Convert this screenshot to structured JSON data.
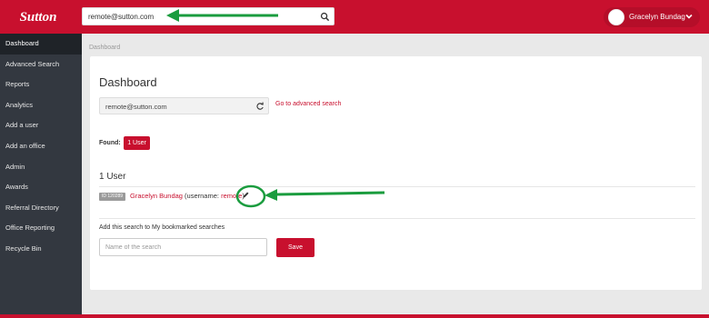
{
  "brand": {
    "logo_text": "Sutton",
    "accent_color": "#c8102e"
  },
  "search": {
    "value": "remote@sutton.com",
    "icon": "search-icon"
  },
  "user": {
    "name": "Gracelyn Bundag",
    "icon": "chevron-down-icon"
  },
  "sidebar": {
    "items": [
      {
        "label": "Dashboard",
        "active": true
      },
      {
        "label": "Advanced Search"
      },
      {
        "label": "Reports"
      },
      {
        "label": "Analytics"
      },
      {
        "label": "Add a user"
      },
      {
        "label": "Add an office"
      },
      {
        "label": "Admin"
      },
      {
        "label": "Awards"
      },
      {
        "label": "Referral Directory"
      },
      {
        "label": "Office Reporting"
      },
      {
        "label": "Recycle Bin"
      }
    ]
  },
  "breadcrumb": "Dashboard",
  "main": {
    "title": "Dashboard",
    "query": "remote@sutton.com",
    "advanced_link": "Go to advanced search",
    "found_label": "Found:",
    "found_button": "1 User",
    "result_count_title": "1 User",
    "result": {
      "id_badge": "ID 120289",
      "name": "Gracelyn Bundag",
      "username_prefix": "(username: ",
      "username": "remote",
      "username_suffix": ")"
    },
    "bookmark_label": "Add this search to My bookmarked searches",
    "bookmark_placeholder": "Name of the search",
    "save_label": "Save"
  },
  "annotations": {
    "arrow_color": "#1a9c3e"
  }
}
